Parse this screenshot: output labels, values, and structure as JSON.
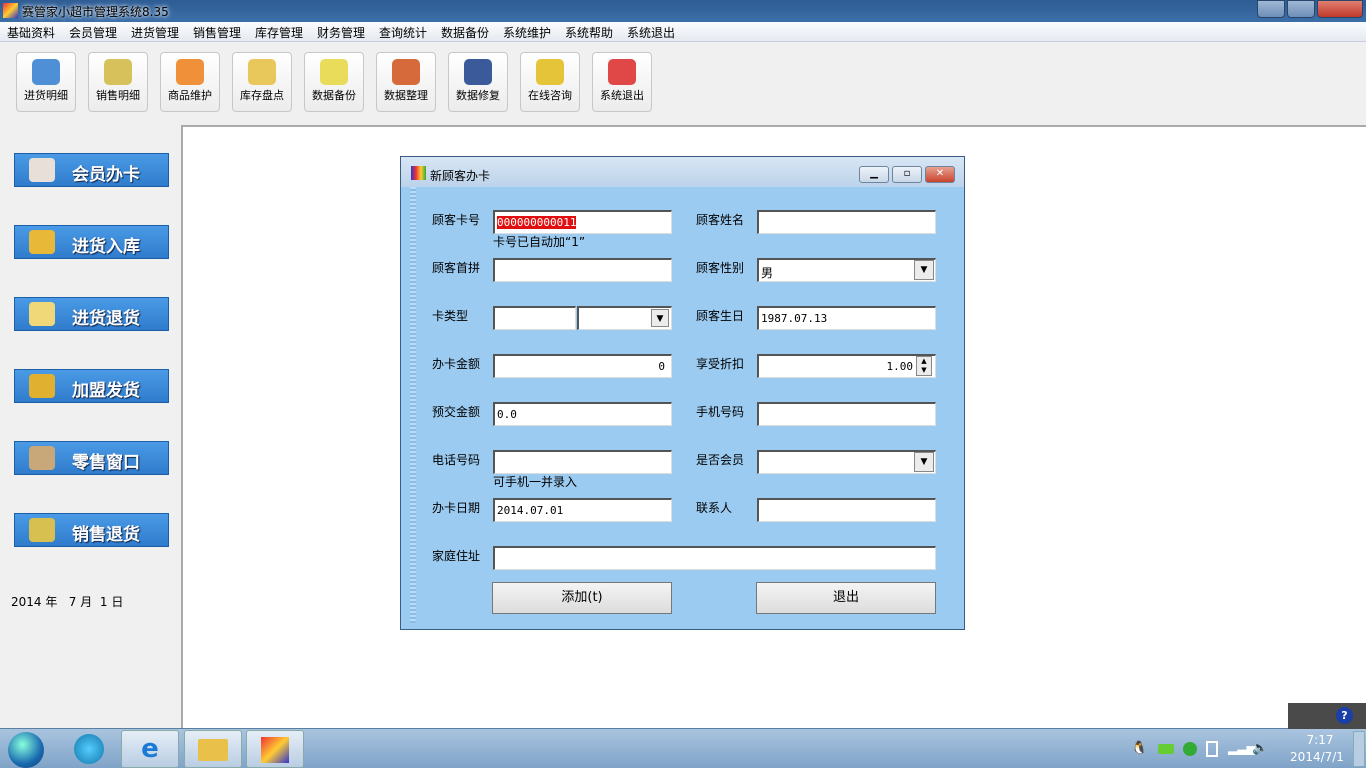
{
  "app": {
    "title": "赛管家小超市管理系统8.35"
  },
  "menu": [
    "基础资料",
    "会员管理",
    "进货管理",
    "销售管理",
    "库存管理",
    "财务管理",
    "查询统计",
    "数据备份",
    "系统维护",
    "系统帮助",
    "系统退出"
  ],
  "toolbar": [
    {
      "label": "进货明细",
      "icon": "pencil-icon",
      "color": "#4f8fd6"
    },
    {
      "label": "销售明细",
      "icon": "folder-icon",
      "color": "#d6c15a"
    },
    {
      "label": "商品维护",
      "icon": "box-icon",
      "color": "#f0913a"
    },
    {
      "label": "库存盘点",
      "icon": "notepad-icon",
      "color": "#e8c85a"
    },
    {
      "label": "数据备份",
      "icon": "disc-icon",
      "color": "#e8dc5a"
    },
    {
      "label": "数据整理",
      "icon": "pie-chart-icon",
      "color": "#d66a3a"
    },
    {
      "label": "数据修复",
      "icon": "floppy-wrench-icon",
      "color": "#3a5a9a"
    },
    {
      "label": "在线咨询",
      "icon": "consult-icon",
      "color": "#e6c43a"
    },
    {
      "label": "系统退出",
      "icon": "power-icon",
      "color": "#e04848"
    }
  ],
  "sidebar": [
    {
      "label": "会员办卡",
      "icon": "member-icon",
      "color": "#e8e0d8"
    },
    {
      "label": "进货入库",
      "icon": "stock-in-icon",
      "color": "#e8b838"
    },
    {
      "label": "进货退货",
      "icon": "return-icon",
      "color": "#f0d878"
    },
    {
      "label": "加盟发货",
      "icon": "coins-icon",
      "color": "#e0b030"
    },
    {
      "label": "零售窗口",
      "icon": "retail-icon",
      "color": "#c8a878"
    },
    {
      "label": "销售退货",
      "icon": "cash-icon",
      "color": "#d8c050"
    }
  ],
  "date": "2014 年   7 月  1 日",
  "dialog": {
    "title": "新顾客办卡",
    "fields": {
      "card_no": {
        "label": "顾客卡号",
        "value": "000000000011",
        "hint": "卡号已自动加“1”"
      },
      "name": {
        "label": "顾客姓名",
        "value": ""
      },
      "pinyin": {
        "label": "顾客首拼",
        "value": ""
      },
      "gender": {
        "label": "顾客性别",
        "value": "男"
      },
      "card_type": {
        "label": "卡类型",
        "value": ""
      },
      "birthday": {
        "label": "顾客生日",
        "value": "1987.07.13"
      },
      "amount": {
        "label": "办卡金额",
        "value": "0"
      },
      "discount": {
        "label": "享受折扣",
        "value": "1.00"
      },
      "prepay": {
        "label": "预交金额",
        "value": "0.0"
      },
      "mobile": {
        "label": "手机号码",
        "value": ""
      },
      "phone": {
        "label": "电话号码",
        "value": "",
        "hint": "可手机一并录入"
      },
      "is_member": {
        "label": "是否会员",
        "value": ""
      },
      "date": {
        "label": "办卡日期",
        "value": "2014.07.01"
      },
      "contact": {
        "label": "联系人",
        "value": ""
      },
      "address": {
        "label": "家庭住址",
        "value": ""
      }
    },
    "add_label": "添加(t)",
    "exit_label": "退出"
  },
  "taskbar": {
    "time": "7:17",
    "date": "2014/7/1"
  }
}
